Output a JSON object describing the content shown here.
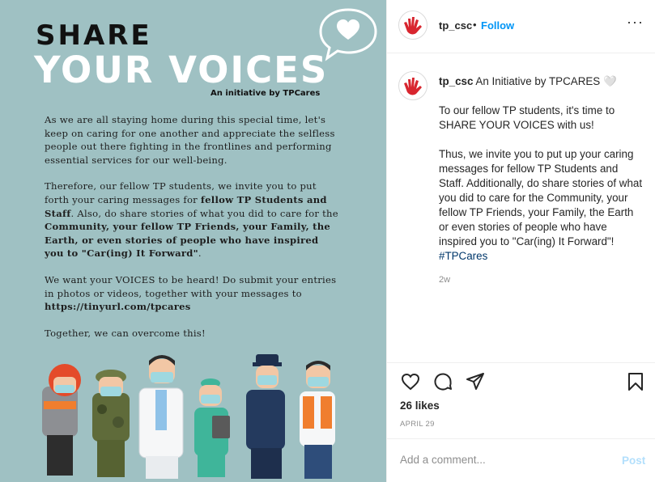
{
  "poster": {
    "title_line1": "SHARE",
    "title_line2": "YOUR VOICES",
    "subtitle": "An initiative by TPCares",
    "p1": "As we are all staying home during this special time, let's keep on caring for one another and appreciate the selfless people out there fighting in the frontlines and performing essential services for our well-being.",
    "p2_a": "Therefore, our fellow TP students, we invite you to put forth your caring messages for ",
    "p2_b": "fellow TP Students and Staff",
    "p2_c": ". Also, do share stories of what you did to care for the ",
    "p2_d": "Community, your fellow TP Friends, your Family, the Earth, or even stories of people who have inspired you to \"Car(ing) It Forward\"",
    "p2_e": ".",
    "p3_a": "We want your VOICES to be heard! Do submit your entries in photos or videos, together with your messages to ",
    "p3_b": "https://tinyurl.com/tpcares",
    "p4": "Together, we can overcome this!"
  },
  "header": {
    "username": "tp_csc",
    "separator": "•",
    "follow_label": "Follow",
    "more_label": "···"
  },
  "caption": {
    "username": "tp_csc",
    "intro": "An Initiative by TPCARES 🤍",
    "para1": "To our fellow TP students, it's time to SHARE YOUR VOICES with us!",
    "para2": "Thus, we invite you to put up your caring messages for fellow TP Students and Staff. Additionally, do share stories of what you did to care for the Community, your fellow TP Friends, your Family, the Earth or even stories of people who have inspired you to \"Car(ing) It Forward\"! ",
    "hashtag": "#TPCares",
    "age": "2w"
  },
  "engagement": {
    "likes": "26 likes",
    "date": "APRIL 29"
  },
  "comment": {
    "placeholder": "Add a comment...",
    "post_label": "Post"
  },
  "icons": {
    "heart": "heart-icon",
    "comment": "comment-icon",
    "share": "send-icon",
    "save": "bookmark-icon",
    "logo": "tpcares-hand-logo"
  },
  "colors": {
    "poster_bg": "#9fc1c3",
    "follow": "#0095f6",
    "post_disabled": "#b2dffc",
    "hashtag": "#00376b",
    "logo_red": "#d8262f"
  }
}
